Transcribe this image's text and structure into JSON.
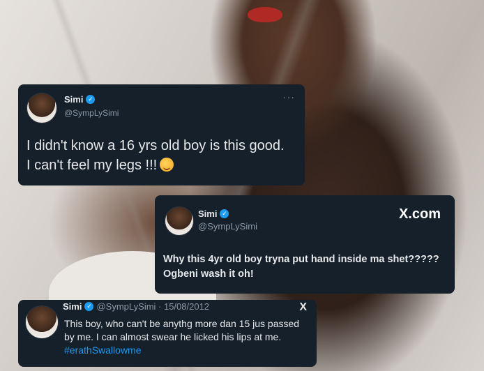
{
  "tweets": [
    {
      "name": "Simi",
      "handle": "@SympLySimi",
      "more": "···",
      "text": "I didn't know a 16 yrs old boy is this good. I can't feel my legs !!!"
    },
    {
      "name": "Simi",
      "handle": "@SympLySimi",
      "brand": "X.com",
      "text": "Why this 4yr old boy tryna put hand inside ma shet????? Ogbeni wash it oh!"
    },
    {
      "name": "Simi",
      "meta": "@SympLySimi · 15/08/2012",
      "x_logo": "X",
      "text": "This boy, who can't be anythg more dan 15 jus passed by me. I can almost swear he licked his lips at me. ",
      "hashtag": "#erathSwallowme"
    }
  ],
  "icons": {
    "verified": "verified-check-icon",
    "emoji": "smiling-face-with-hearts-emoji"
  },
  "colors": {
    "card_bg": "#15202b",
    "verified": "#1d9bf0",
    "secondary_text": "#8b98a5"
  }
}
